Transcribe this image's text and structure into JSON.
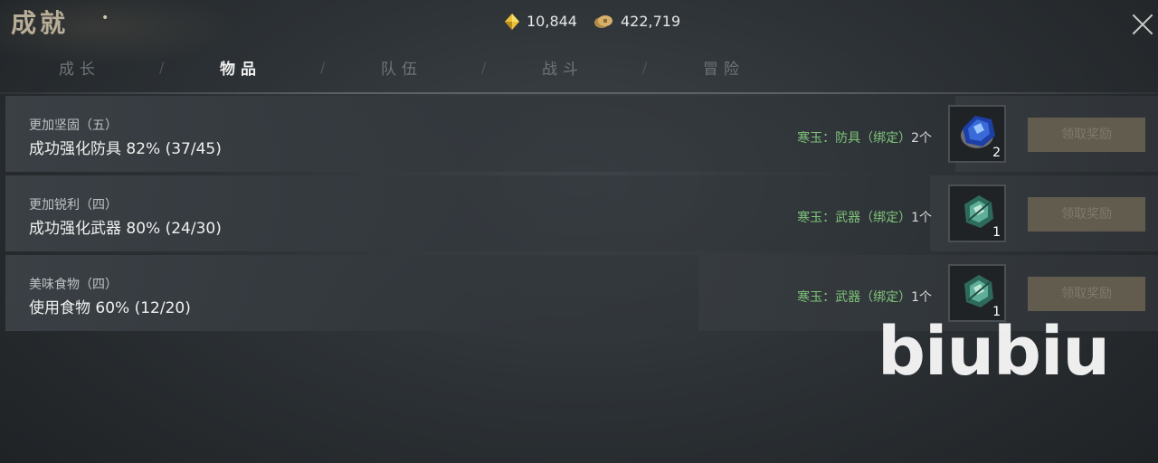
{
  "header": {
    "title": "成就",
    "currencies": [
      {
        "icon": "jade-diamond-icon",
        "value": "10,844"
      },
      {
        "icon": "copper-coin-icon",
        "value": "422,719"
      }
    ]
  },
  "tabs": [
    {
      "label": "成长",
      "active": false
    },
    {
      "label": "物品",
      "active": true
    },
    {
      "label": "队伍",
      "active": false
    },
    {
      "label": "战斗",
      "active": false
    },
    {
      "label": "冒险",
      "active": false
    }
  ],
  "achievements": [
    {
      "name": "更加坚固（五）",
      "description": "成功强化防具 82% (37/45)",
      "progress": 0.82,
      "reward_label": "寒玉：防具（绑定）",
      "reward_count": "2个",
      "item_icon": "blue-jade-armor-icon",
      "item_qty": "2",
      "claim_label": "领取奖励"
    },
    {
      "name": "更加锐利（四）",
      "description": "成功强化武器 80% (24/30)",
      "progress": 0.8,
      "reward_label": "寒玉：武器（绑定）",
      "reward_count": "1个",
      "item_icon": "green-jade-weapon-icon",
      "item_qty": "1",
      "claim_label": "领取奖励"
    },
    {
      "name": "美味食物（四）",
      "description": "使用食物 60% (12/20)",
      "progress": 0.6,
      "reward_label": "寒玉：武器（绑定）",
      "reward_count": "1个",
      "item_icon": "green-jade-weapon-icon",
      "item_qty": "1",
      "claim_label": "领取奖励"
    }
  ],
  "watermark": "biubiu",
  "colors": {
    "reward_green": "#7fc37a",
    "claim_button": "#6b6353",
    "active_tab": "#f0f0f0",
    "inactive_tab": "#6f7478"
  }
}
